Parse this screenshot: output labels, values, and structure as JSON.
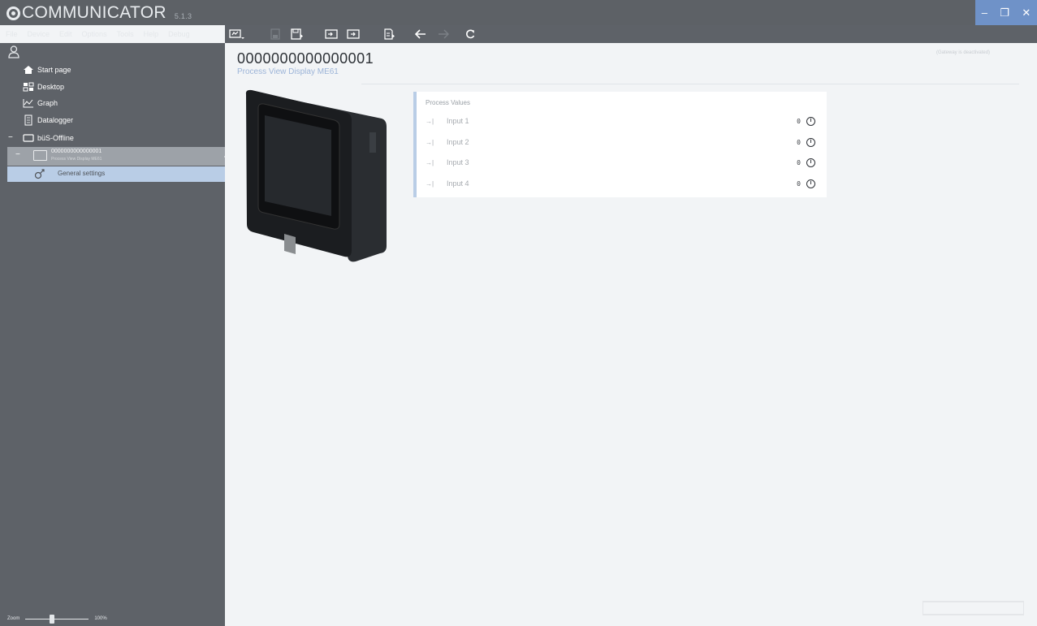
{
  "app": {
    "title": "COMMUNICATOR",
    "version": "5.1.3"
  },
  "window_controls": {
    "minimize": "–",
    "maximize": "❐",
    "close": "✕"
  },
  "menu": [
    "File",
    "Device",
    "Edit",
    "Options",
    "Tools",
    "Help",
    "Debug"
  ],
  "toolbar": {
    "icons": [
      "connect-icon",
      "save-disabled-icon",
      "save-as-icon",
      "import-icon",
      "export-icon",
      "report-icon",
      "back-arrow-icon",
      "forward-arrow-icon",
      "refresh-icon"
    ]
  },
  "sidebar": {
    "items": [
      {
        "label": "Start page",
        "icon": "home-icon"
      },
      {
        "label": "Desktop",
        "icon": "desktop-icon"
      },
      {
        "label": "Graph",
        "icon": "graph-icon"
      },
      {
        "label": "Datalogger",
        "icon": "datalogger-icon"
      }
    ],
    "bus": {
      "label": "büS-Offline",
      "collapse": "−"
    },
    "device": {
      "id": "0000000000000001",
      "name": "Process View Display ME61",
      "collapse": "−"
    },
    "general_settings": "General settings"
  },
  "zoom": {
    "label": "Zoom",
    "percent_text": "100%",
    "level": 1.0
  },
  "main": {
    "device_id": "0000000000000001",
    "device_name": "Process View Display ME61",
    "status_right": "(Gateway is deactivated)"
  },
  "process_values": {
    "title": "Process Values",
    "arrow": "→|",
    "rows": [
      {
        "label": "Input 1",
        "value": "0"
      },
      {
        "label": "Input 2",
        "value": "0"
      },
      {
        "label": "Input 3",
        "value": "0"
      },
      {
        "label": "Input 4",
        "value": "0"
      }
    ]
  },
  "colors": {
    "sidebar_bg": "#5e6268",
    "accent_blue": "#b9cde6",
    "window_controls_bg": "#6f92c8",
    "link_blue": "#9cb4d8"
  }
}
